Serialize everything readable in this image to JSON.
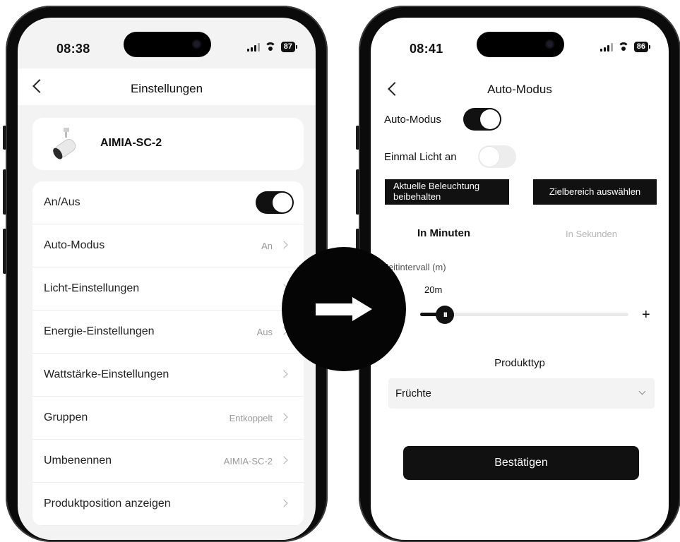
{
  "left_phone": {
    "status": {
      "time": "08:38",
      "battery": "87"
    },
    "nav": {
      "title": "Einstellungen"
    },
    "device": {
      "name": "AIMIA-SC-2"
    },
    "settings": [
      {
        "label": "An/Aus",
        "value": "",
        "toggle": "on"
      },
      {
        "label": "Auto-Modus",
        "value": "An"
      },
      {
        "label": "Licht-Einstellungen",
        "value": ""
      },
      {
        "label": "Energie-Einstellungen",
        "value": "Aus"
      },
      {
        "label": "Wattstärke-Einstellungen",
        "value": ""
      },
      {
        "label": "Gruppen",
        "value": "Entkoppelt"
      },
      {
        "label": "Umbenennen",
        "value": "AIMIA-SC-2"
      },
      {
        "label": "Produktposition anzeigen",
        "value": ""
      }
    ]
  },
  "right_phone": {
    "status": {
      "time": "08:41",
      "battery": "86"
    },
    "nav": {
      "title": "Auto-Modus"
    },
    "auto_mode": {
      "label": "Auto-Modus",
      "state": "on"
    },
    "light_once": {
      "label": "Einmal Licht an",
      "state": "off"
    },
    "buttons": {
      "keep_lighting": "Aktuelle Beleuchtung beibehalten",
      "select_target": "Zielbereich auswählen"
    },
    "tabs": {
      "minutes": "In Minuten",
      "seconds": "In Sekunden"
    },
    "interval": {
      "label": "Zeitintervall (m)",
      "value_text": "20m",
      "fraction": 0.12,
      "thumb_glyph": "III",
      "plus": "+"
    },
    "product": {
      "label": "Produkttyp",
      "selected": "Früchte"
    },
    "confirm": "Bestätigen"
  },
  "colors": {
    "primary": "#111111",
    "background": "#f3f3f3",
    "muted": "#9a9a9a"
  }
}
